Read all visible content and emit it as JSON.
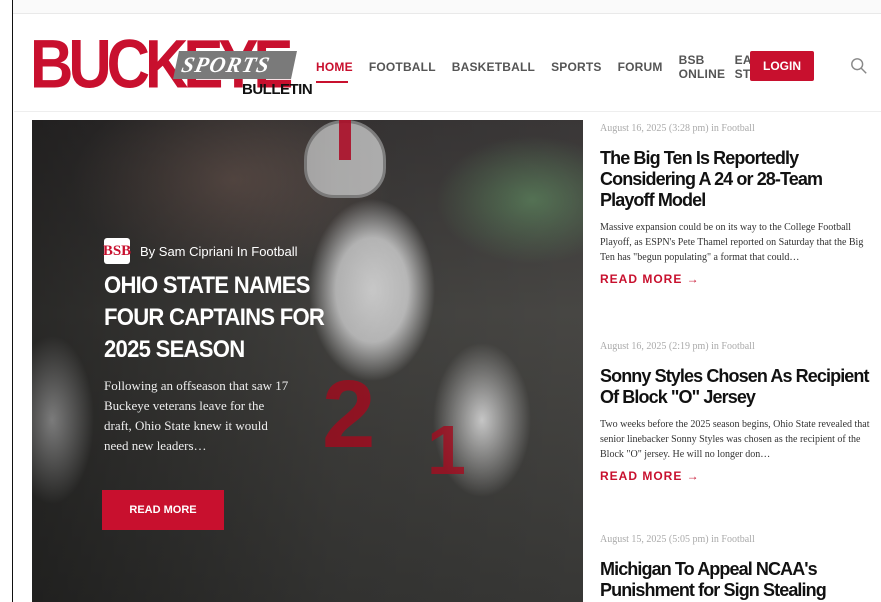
{
  "site": {
    "logo_main": "BUCKEYE",
    "logo_sports": "SPORTS",
    "logo_bulletin": "BULLETIN",
    "accent_color": "#c8102e"
  },
  "nav": {
    "items": [
      {
        "label": "HOME",
        "active": true
      },
      {
        "label": "FOOTBALL"
      },
      {
        "label": "BASKETBALL"
      },
      {
        "label": "SPORTS"
      },
      {
        "label": "FORUM"
      },
      {
        "label": "BSB ONLINE"
      },
      {
        "label": "EAT & STAY"
      }
    ],
    "login_label": "LOGIN",
    "search_icon": "search-icon"
  },
  "hero": {
    "badge": "BSB",
    "byline": "By Sam Cipriani In Football",
    "title": "OHIO STATE NAMES FOUR CAPTAINS FOR 2025 SEASON",
    "excerpt": "Following an offseason that saw 17 Buckeye veterans leave for the draft, Ohio State knew it would need new leaders…",
    "read_more": "READ MORE",
    "jersey_number_main": "2",
    "jersey_number_back": "1"
  },
  "articles": [
    {
      "meta": "August 16, 2025 (3:28 pm) in Football",
      "title": "The Big Ten Is Reportedly Considering A 24 or 28-Team Playoff Model",
      "excerpt": "Massive expansion could be on its way to the College Football Playoff, as ESPN's Pete Thamel reported on Saturday that the Big Ten has \"begun populating\" a format that could…",
      "read_more": "READ MORE →"
    },
    {
      "meta": "August 16, 2025 (2:19 pm) in Football",
      "title": "Sonny Styles Chosen As Recipient Of Block \"O\" Jersey",
      "excerpt": "Two weeks before the 2025 season begins, Ohio State revealed that senior linebacker Sonny Styles was chosen as the recipient of the Block \"O\" jersey. He will no longer don…",
      "read_more": "READ MORE →"
    },
    {
      "meta": "August 15, 2025 (5:05 pm) in Football",
      "title": "Michigan To Appeal NCAA's Punishment for Sign Stealing"
    }
  ]
}
